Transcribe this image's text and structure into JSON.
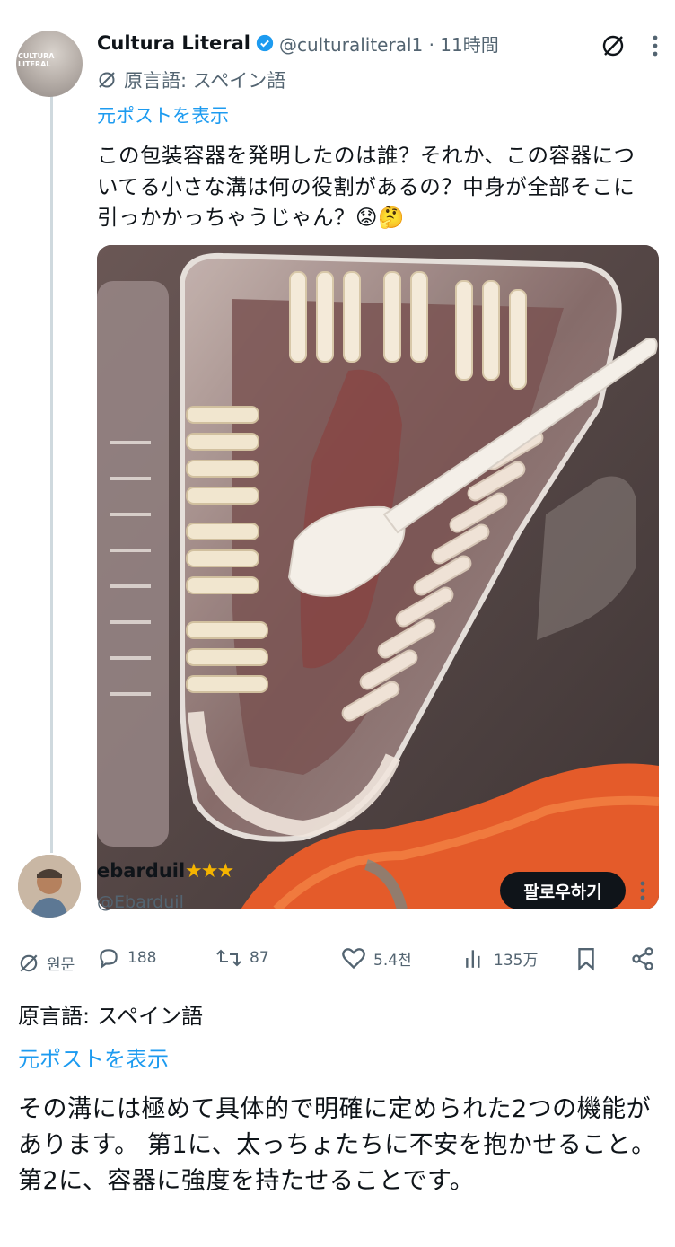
{
  "post": {
    "author_name": "Cultura Literal",
    "handle_time": "@culturaliteral1 · 11時間",
    "avatar_text": "CULTURA LITERAL",
    "original_language": "原言語: スペイン語",
    "show_original": "元ポストを表示",
    "text": "この包装容器を発明したのは誰？それか、この容器についてる小さな溝は何の役割があるの？中身が全部そこに引っかかっちゃうじゃん？😟🤔"
  },
  "reply": {
    "author_name": "ebarduil",
    "stars": "★★★",
    "handle": "@Ebarduil",
    "follow_label": "팔로우하기",
    "original_label": "원문",
    "replies": "188",
    "reposts": "87",
    "likes": "5.4천",
    "views": "135万",
    "original_language": "原言語: スペイン語",
    "show_original": "元ポストを表示",
    "text": "その溝には極めて具体的で明確に定められた2つの機能があります。 第1に、太っちょたちに不安を抱かせること。第2に、容器に強度を持たせることです。"
  },
  "colors": {
    "link": "#1d9bf0",
    "secondary": "#536471",
    "verified": "#1d9bf0"
  }
}
